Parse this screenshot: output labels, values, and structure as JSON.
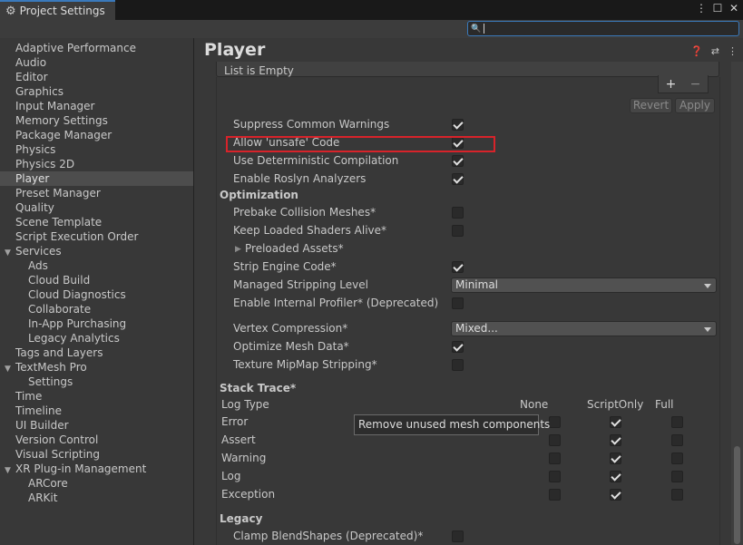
{
  "window": {
    "tab_title": "Project Settings",
    "menu_glyph": "⋮",
    "max_glyph": "☐",
    "close_glyph": "✕"
  },
  "search": {
    "value": "",
    "placeholder": ""
  },
  "sidebar": {
    "items": [
      {
        "label": "Adaptive Performance",
        "level": 0
      },
      {
        "label": "Audio",
        "level": 0
      },
      {
        "label": "Editor",
        "level": 0
      },
      {
        "label": "Graphics",
        "level": 0
      },
      {
        "label": "Input Manager",
        "level": 0
      },
      {
        "label": "Memory Settings",
        "level": 0
      },
      {
        "label": "Package Manager",
        "level": 0
      },
      {
        "label": "Physics",
        "level": 0
      },
      {
        "label": "Physics 2D",
        "level": 0
      },
      {
        "label": "Player",
        "level": 0,
        "selected": true
      },
      {
        "label": "Preset Manager",
        "level": 0
      },
      {
        "label": "Quality",
        "level": 0
      },
      {
        "label": "Scene Template",
        "level": 0
      },
      {
        "label": "Script Execution Order",
        "level": 0
      },
      {
        "label": "Services",
        "level": "group"
      },
      {
        "label": "Ads",
        "level": 1
      },
      {
        "label": "Cloud Build",
        "level": 1
      },
      {
        "label": "Cloud Diagnostics",
        "level": 1
      },
      {
        "label": "Collaborate",
        "level": 1
      },
      {
        "label": "In-App Purchasing",
        "level": 1
      },
      {
        "label": "Legacy Analytics",
        "level": 1
      },
      {
        "label": "Tags and Layers",
        "level": 0
      },
      {
        "label": "TextMesh Pro",
        "level": "group"
      },
      {
        "label": "Settings",
        "level": 1
      },
      {
        "label": "Time",
        "level": 0
      },
      {
        "label": "Timeline",
        "level": 0
      },
      {
        "label": "UI Builder",
        "level": 0
      },
      {
        "label": "Version Control",
        "level": 0
      },
      {
        "label": "Visual Scripting",
        "level": 0
      },
      {
        "label": "XR Plug-in Management",
        "level": "group"
      },
      {
        "label": "ARCore",
        "level": 1
      },
      {
        "label": "ARKit",
        "level": 1
      }
    ]
  },
  "main": {
    "title": "Player",
    "list_empty": "List is Empty",
    "plus": "+",
    "minus": "−",
    "revert": "Revert",
    "apply": "Apply",
    "settings": {
      "suppress_common_warnings": {
        "label": "Suppress Common Warnings",
        "checked": true
      },
      "allow_unsafe_code": {
        "label": "Allow 'unsafe' Code",
        "checked": true
      },
      "deterministic_compilation": {
        "label": "Use Deterministic Compilation",
        "checked": true
      },
      "roslyn_analyzers": {
        "label": "Enable Roslyn Analyzers",
        "checked": true
      },
      "optimization_header": "Optimization",
      "prebake_collision": {
        "label": "Prebake Collision Meshes*",
        "checked": false
      },
      "keep_loaded_shaders": {
        "label": "Keep Loaded Shaders Alive*",
        "checked": false
      },
      "preloaded_assets": {
        "label": "Preloaded Assets*"
      },
      "strip_engine_code": {
        "label": "Strip Engine Code*",
        "checked": true
      },
      "managed_stripping": {
        "label": "Managed Stripping Level",
        "value": "Minimal"
      },
      "internal_profiler": {
        "label": "Enable Internal Profiler* (Deprecated)",
        "checked": false
      },
      "vertex_compression": {
        "label": "Vertex Compression*",
        "value": "Mixed..."
      },
      "optimize_mesh_data": {
        "label": "Optimize Mesh Data*",
        "checked": true
      },
      "texture_mipmap_stripping": {
        "label": "Texture MipMap Stripping*",
        "checked": false
      },
      "stack_trace_header": "Stack Trace*",
      "legacy_header": "Legacy",
      "clamp_blendshapes": {
        "label": "Clamp BlendShapes (Deprecated)*",
        "checked": false
      }
    },
    "stack_trace": {
      "columns": [
        "Log Type",
        "None",
        "ScriptOnly",
        "Full"
      ],
      "rows": [
        {
          "type": "Error",
          "none": false,
          "script_only": true,
          "full": false
        },
        {
          "type": "Assert",
          "none": false,
          "script_only": true,
          "full": false
        },
        {
          "type": "Warning",
          "none": false,
          "script_only": true,
          "full": false
        },
        {
          "type": "Log",
          "none": false,
          "script_only": true,
          "full": false
        },
        {
          "type": "Exception",
          "none": false,
          "script_only": true,
          "full": false
        }
      ]
    },
    "tooltip": "Remove unused mesh components"
  },
  "colors": {
    "highlight": "#d8232a",
    "accent": "#3a79bb"
  }
}
